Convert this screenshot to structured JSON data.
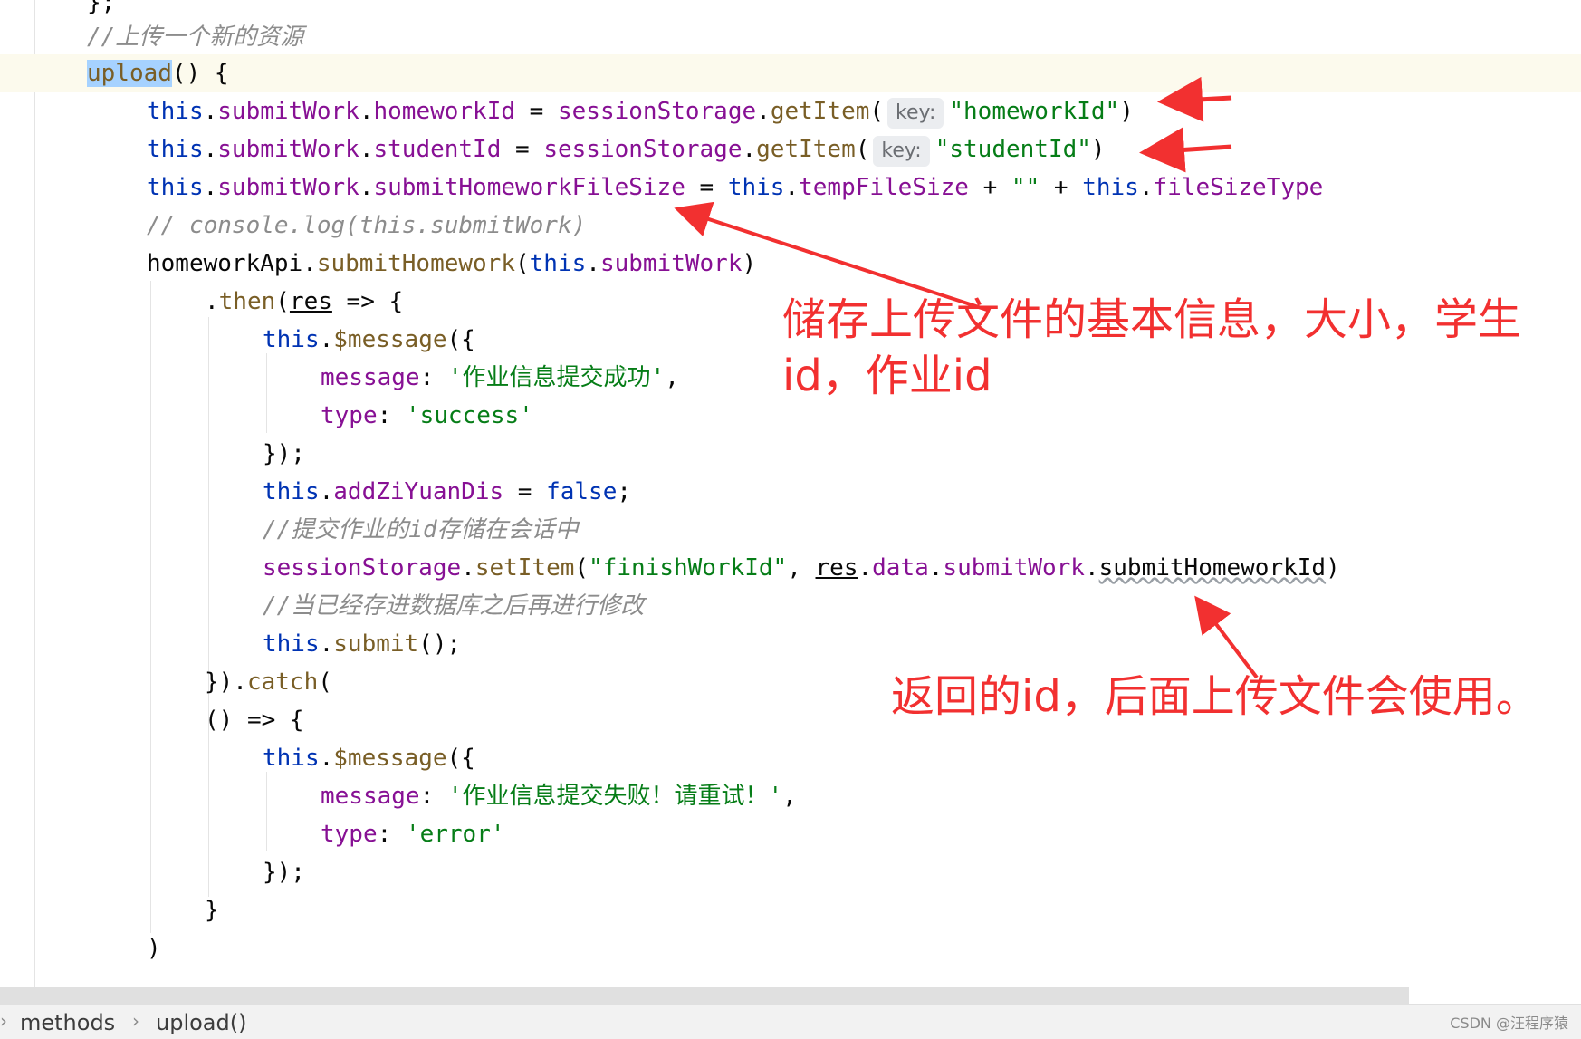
{
  "colors": {
    "keyword": "#0033b3",
    "property": "#871094",
    "function": "#795e26",
    "string": "#067d17",
    "plain": "#080808",
    "comment": "#8c8c8c",
    "annotation": "#f23030",
    "current_line": "#fcfaed",
    "selection": "#a6d2ff"
  },
  "editor": {
    "lines": [
      {
        "tokens": [
          {
            "t": "};",
            "c": "plain"
          }
        ]
      },
      {
        "tokens": [
          {
            "t": "//上传一个新的资源",
            "c": "comment"
          }
        ]
      },
      {
        "tokens": [
          {
            "t": "upload",
            "c": "fn",
            "sel": true
          },
          {
            "t": "() {",
            "c": "plain"
          }
        ]
      },
      {
        "tokens": [
          {
            "t": "this",
            "c": "kw"
          },
          {
            "t": ".",
            "c": "plain"
          },
          {
            "t": "submitWork",
            "c": "prop"
          },
          {
            "t": ".",
            "c": "plain"
          },
          {
            "t": "homeworkId",
            "c": "prop"
          },
          {
            "t": " = ",
            "c": "plain"
          },
          {
            "t": "sessionStorage",
            "c": "prop"
          },
          {
            "t": ".",
            "c": "plain"
          },
          {
            "t": "getItem",
            "c": "fn"
          },
          {
            "t": "(",
            "c": "plain"
          },
          {
            "t": "key:",
            "hint": true
          },
          {
            "t": "\"homeworkId\"",
            "c": "str"
          },
          {
            "t": ")",
            "c": "plain"
          }
        ]
      },
      {
        "tokens": [
          {
            "t": "this",
            "c": "kw"
          },
          {
            "t": ".",
            "c": "plain"
          },
          {
            "t": "submitWork",
            "c": "prop"
          },
          {
            "t": ".",
            "c": "plain"
          },
          {
            "t": "studentId",
            "c": "prop"
          },
          {
            "t": " = ",
            "c": "plain"
          },
          {
            "t": "sessionStorage",
            "c": "prop"
          },
          {
            "t": ".",
            "c": "plain"
          },
          {
            "t": "getItem",
            "c": "fn"
          },
          {
            "t": "(",
            "c": "plain"
          },
          {
            "t": "key:",
            "hint": true
          },
          {
            "t": "\"studentId\"",
            "c": "str"
          },
          {
            "t": ")",
            "c": "plain"
          }
        ]
      },
      {
        "tokens": [
          {
            "t": "this",
            "c": "kw"
          },
          {
            "t": ".",
            "c": "plain"
          },
          {
            "t": "submitWork",
            "c": "prop"
          },
          {
            "t": ".",
            "c": "plain"
          },
          {
            "t": "submitHomeworkFileSize",
            "c": "prop"
          },
          {
            "t": " = ",
            "c": "plain"
          },
          {
            "t": "this",
            "c": "kw"
          },
          {
            "t": ".",
            "c": "plain"
          },
          {
            "t": "tempFileSize",
            "c": "prop"
          },
          {
            "t": " + ",
            "c": "plain"
          },
          {
            "t": "\"\"",
            "c": "str"
          },
          {
            "t": " + ",
            "c": "plain"
          },
          {
            "t": "this",
            "c": "kw"
          },
          {
            "t": ".",
            "c": "plain"
          },
          {
            "t": "fileSizeType",
            "c": "prop"
          }
        ]
      },
      {
        "tokens": [
          {
            "t": "// console.log(this.submitWork)",
            "c": "comment"
          }
        ]
      },
      {
        "tokens": [
          {
            "t": "homeworkApi",
            "c": "plain"
          },
          {
            "t": ".",
            "c": "plain"
          },
          {
            "t": "submitHomework",
            "c": "fn"
          },
          {
            "t": "(",
            "c": "plain"
          },
          {
            "t": "this",
            "c": "kw"
          },
          {
            "t": ".",
            "c": "plain"
          },
          {
            "t": "submitWork",
            "c": "prop"
          },
          {
            "t": ")",
            "c": "plain"
          }
        ]
      },
      {
        "tokens": [
          {
            "t": ".",
            "c": "plain"
          },
          {
            "t": "then",
            "c": "fn"
          },
          {
            "t": "(",
            "c": "plain"
          },
          {
            "t": "res",
            "c": "plain",
            "ul": true
          },
          {
            "t": " => {",
            "c": "plain"
          }
        ]
      },
      {
        "tokens": [
          {
            "t": "this",
            "c": "kw"
          },
          {
            "t": ".",
            "c": "plain"
          },
          {
            "t": "$message",
            "c": "fn"
          },
          {
            "t": "({",
            "c": "plain"
          }
        ]
      },
      {
        "tokens": [
          {
            "t": "message",
            "c": "prop"
          },
          {
            "t": ": ",
            "c": "plain"
          },
          {
            "t": "'作业信息提交成功'",
            "c": "str"
          },
          {
            "t": ",",
            "c": "plain"
          }
        ]
      },
      {
        "tokens": [
          {
            "t": "type",
            "c": "prop"
          },
          {
            "t": ": ",
            "c": "plain"
          },
          {
            "t": "'success'",
            "c": "str"
          }
        ]
      },
      {
        "tokens": [
          {
            "t": "});",
            "c": "plain"
          }
        ]
      },
      {
        "tokens": [
          {
            "t": "this",
            "c": "kw"
          },
          {
            "t": ".",
            "c": "plain"
          },
          {
            "t": "addZiYuanDis",
            "c": "prop"
          },
          {
            "t": " = ",
            "c": "plain"
          },
          {
            "t": "false",
            "c": "kw"
          },
          {
            "t": ";",
            "c": "plain"
          }
        ]
      },
      {
        "tokens": [
          {
            "t": "//提交作业的id存储在会话中",
            "c": "comment"
          }
        ]
      },
      {
        "tokens": [
          {
            "t": "sessionStorage",
            "c": "prop"
          },
          {
            "t": ".",
            "c": "plain"
          },
          {
            "t": "setItem",
            "c": "fn"
          },
          {
            "t": "(",
            "c": "plain"
          },
          {
            "t": "\"finishWorkId\"",
            "c": "str"
          },
          {
            "t": ", ",
            "c": "plain"
          },
          {
            "t": "res",
            "c": "plain",
            "ul": true
          },
          {
            "t": ".",
            "c": "plain"
          },
          {
            "t": "data",
            "c": "prop"
          },
          {
            "t": ".",
            "c": "plain"
          },
          {
            "t": "submitWork",
            "c": "prop"
          },
          {
            "t": ".",
            "c": "plain"
          },
          {
            "t": "submitHomeworkId",
            "c": "plain",
            "wavy": true
          },
          {
            "t": ")",
            "c": "plain"
          }
        ]
      },
      {
        "tokens": [
          {
            "t": "//当已经存进数据库之后再进行修改",
            "c": "comment"
          }
        ]
      },
      {
        "tokens": [
          {
            "t": "this",
            "c": "kw"
          },
          {
            "t": ".",
            "c": "plain"
          },
          {
            "t": "submit",
            "c": "fn"
          },
          {
            "t": "();",
            "c": "plain"
          }
        ]
      },
      {
        "tokens": [
          {
            "t": "}).",
            "c": "plain"
          },
          {
            "t": "catch",
            "c": "fn"
          },
          {
            "t": "(",
            "c": "plain"
          }
        ]
      },
      {
        "tokens": [
          {
            "t": "() => {",
            "c": "plain"
          }
        ]
      },
      {
        "tokens": [
          {
            "t": "this",
            "c": "kw"
          },
          {
            "t": ".",
            "c": "plain"
          },
          {
            "t": "$message",
            "c": "fn"
          },
          {
            "t": "({",
            "c": "plain"
          }
        ]
      },
      {
        "tokens": [
          {
            "t": "message",
            "c": "prop"
          },
          {
            "t": ": ",
            "c": "plain"
          },
          {
            "t": "'作业信息提交失败！请重试！'",
            "c": "str"
          },
          {
            "t": ",",
            "c": "plain"
          }
        ]
      },
      {
        "tokens": [
          {
            "t": "type",
            "c": "prop"
          },
          {
            "t": ": ",
            "c": "plain"
          },
          {
            "t": "'error'",
            "c": "str"
          }
        ]
      },
      {
        "tokens": [
          {
            "t": "});",
            "c": "plain"
          }
        ]
      },
      {
        "tokens": [
          {
            "t": "}",
            "c": "plain"
          }
        ]
      },
      {
        "tokens": [
          {
            "t": ")",
            "c": "plain"
          }
        ]
      }
    ]
  },
  "annotations": {
    "file_info_note": "储存上传文件的基本信息，大小，学生id，作业id",
    "returned_id_note": "返回的id，后面上传文件会使用。"
  },
  "breadcrumb": {
    "items": [
      "methods",
      "upload()"
    ]
  },
  "watermark": "CSDN @汪程序猿"
}
